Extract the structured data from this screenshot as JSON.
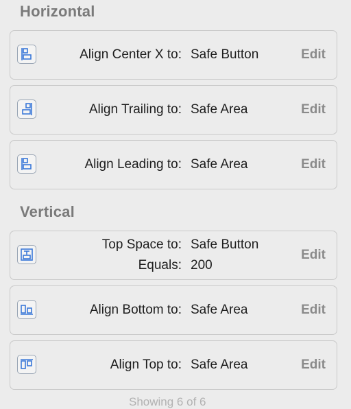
{
  "sections": {
    "horizontal_title": "Horizontal",
    "vertical_title": "Vertical"
  },
  "constraints": [
    {
      "icon": "align-center-x-icon",
      "label": "Align Center X to:",
      "value": "Safe Button",
      "action": "Edit"
    },
    {
      "icon": "align-trailing-icon",
      "label": "Align Trailing to:",
      "value": "Safe Area",
      "action": "Edit"
    },
    {
      "icon": "align-leading-icon",
      "label": "Align Leading to:",
      "value": "Safe Area",
      "action": "Edit"
    },
    {
      "icon": "top-space-icon",
      "label": "Top Space to:",
      "value": "Safe Button",
      "label2": "Equals:",
      "value2": "200",
      "action": "Edit"
    },
    {
      "icon": "align-bottom-icon",
      "label": "Align Bottom to:",
      "value": "Safe Area",
      "action": "Edit"
    },
    {
      "icon": "align-top-icon",
      "label": "Align Top to:",
      "value": "Safe Area",
      "action": "Edit"
    }
  ],
  "footer": {
    "text": "Showing 6 of 6"
  },
  "colors": {
    "icon_blue": "#3a78d8",
    "edit_gray": "#8a8a8a",
    "section_gray": "#7a7a7a"
  }
}
